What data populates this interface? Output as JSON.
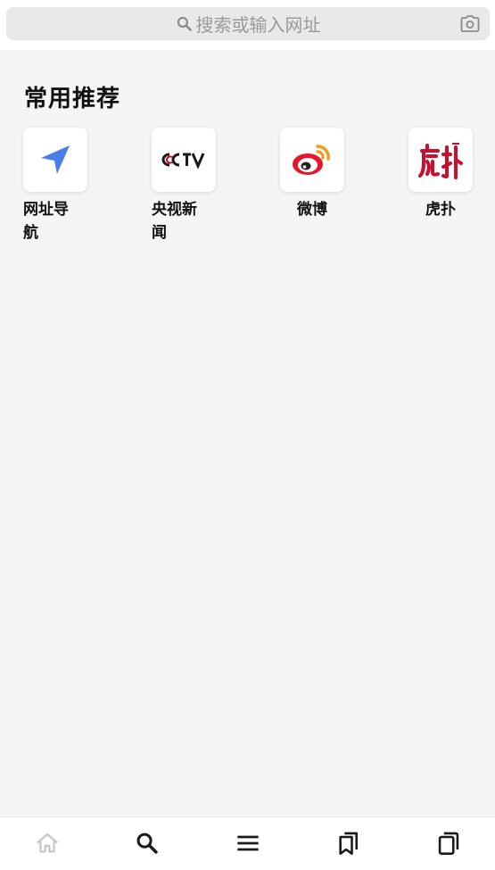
{
  "search": {
    "placeholder": "搜索或输入网址"
  },
  "section": {
    "title": "常用推荐"
  },
  "apps": [
    {
      "label": "网址导航",
      "icon": "navigation-arrow-icon"
    },
    {
      "label": "央视新闻",
      "icon": "cctv-logo-icon"
    },
    {
      "label": "微博",
      "icon": "weibo-logo-icon"
    },
    {
      "label": "虎扑",
      "icon": "hupu-logo-icon"
    }
  ],
  "bottom_nav": [
    {
      "icon": "home-icon"
    },
    {
      "icon": "search-icon"
    },
    {
      "icon": "menu-icon"
    },
    {
      "icon": "bookmarks-icon"
    },
    {
      "icon": "tabs-icon"
    }
  ],
  "colors": {
    "nav_arrow": "#4a7de8",
    "weibo_red": "#e6162d",
    "weibo_orange": "#f59a1c",
    "hupu_red": "#c8102e",
    "inactive_icon": "#c8c8c8"
  }
}
